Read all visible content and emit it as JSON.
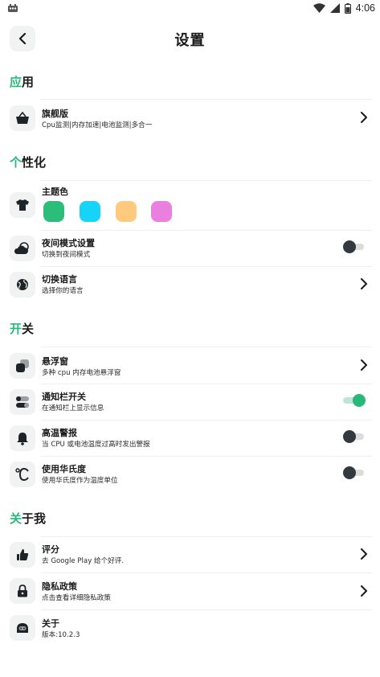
{
  "status_bar": {
    "time": "4:06"
  },
  "header": {
    "title": "设置"
  },
  "sections": {
    "app": {
      "accent": "应",
      "rest": "用"
    },
    "personal": {
      "accent": "个",
      "rest": "性化"
    },
    "switches": {
      "accent": "开",
      "rest": "关"
    },
    "about": {
      "accent": "关",
      "rest": "于我"
    }
  },
  "rows": {
    "premium": {
      "title": "旗舰版",
      "sub": "Cpu监测|内存加速|电池监测|多合一",
      "icon": "basket-icon"
    },
    "theme": {
      "title": "主题色",
      "icon": "tshirt-icon"
    },
    "night": {
      "title": "夜间模式设置",
      "sub": "切换到夜间模式",
      "icon": "cloud-moon-icon",
      "enabled": false
    },
    "language": {
      "title": "切换语言",
      "sub": "选择你的语言",
      "icon": "globe-icon"
    },
    "floating": {
      "title": "悬浮窗",
      "sub": "多种 cpu 内存电池悬浮窗",
      "icon": "floating-window-icon"
    },
    "notification": {
      "title": "通知栏开关",
      "sub": "在通知栏上显示信息",
      "icon": "toggles-icon",
      "enabled": true
    },
    "high_temp": {
      "title": "高温警报",
      "sub": "当 CPU 或电池温度过高时发出警报",
      "icon": "bell-icon",
      "enabled": false
    },
    "fahrenheit": {
      "title": "使用华氏度",
      "sub": "使用华氏度作为温度单位",
      "icon": "celsius-icon",
      "enabled": false
    },
    "rate": {
      "title": "评分",
      "sub": "去 Google Play 给个好评.",
      "icon": "thumbs-up-icon"
    },
    "privacy": {
      "title": "隐私政策",
      "sub": "点击查看详细隐私政策",
      "icon": "lock-icon"
    },
    "about": {
      "title": "关于",
      "sub": "版本:10.2.3",
      "icon": "robot-icon"
    }
  },
  "theme_colors": [
    "#2dbd7b",
    "#16d4f8",
    "#ffc97e",
    "#ea7fe0"
  ],
  "colors": {
    "accent": "#27b87a",
    "icon_bg": "#f1f3f3"
  }
}
